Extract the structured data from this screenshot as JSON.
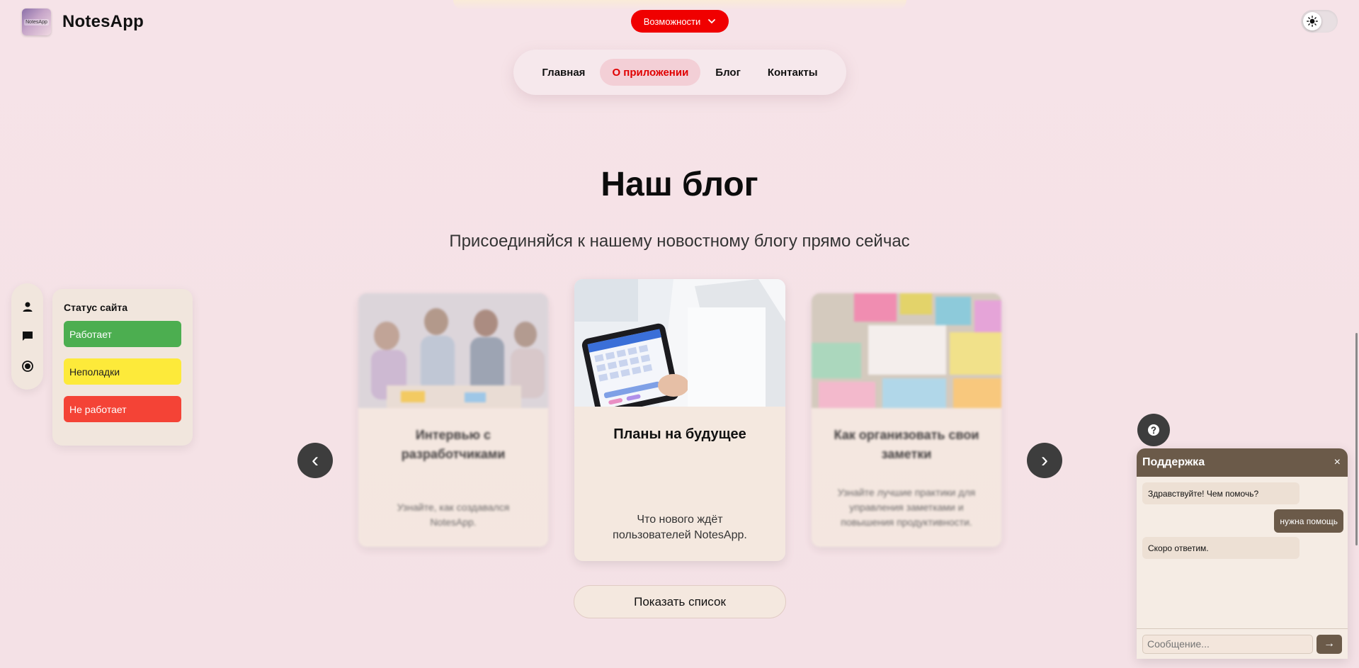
{
  "app": {
    "logo_badge": "NotesApp",
    "name": "NotesApp"
  },
  "features": {
    "label": "Возможности"
  },
  "nav": {
    "items": [
      {
        "label": "Главная",
        "active": false
      },
      {
        "label": "О приложении",
        "active": true
      },
      {
        "label": "Блог",
        "active": false
      },
      {
        "label": "Контакты",
        "active": false
      }
    ]
  },
  "blog": {
    "title": "Наш блог",
    "subtitle": "Присоединяйся к нашему новостному блогу прямо сейчас",
    "cards": [
      {
        "title": "Интервью с разработчиками",
        "desc": "Узнайте, как создавался NotesApp."
      },
      {
        "title": "Планы на будущее",
        "desc": "Что нового ждёт пользователей NotesApp."
      },
      {
        "title": "Как организовать свои заметки",
        "desc": "Узнайте лучшие практики для управления заметками и повышения продуктивности."
      }
    ],
    "prev": "‹",
    "next": "›",
    "show_list": "Показать список"
  },
  "status": {
    "title": "Статус сайта",
    "items": [
      {
        "label": "Работает",
        "color": "#4cae50"
      },
      {
        "label": "Неполадки",
        "color": "#fdea3a"
      },
      {
        "label": "Не работает",
        "color": "#f44336"
      }
    ]
  },
  "side_icons": [
    "user-icon",
    "chat-icon",
    "radio-icon"
  ],
  "chat": {
    "title": "Поддержка",
    "close": "×",
    "messages": [
      {
        "from": "bot",
        "text": "Здравствуйте! Чем помочь?"
      },
      {
        "from": "user",
        "text": "нужна помощь"
      },
      {
        "from": "bot",
        "text": "Скоро ответим."
      }
    ],
    "placeholder": "Сообщение...",
    "send": "→"
  },
  "colors": {
    "accent_red": "#f00000",
    "chat_brown": "#6b5a49",
    "dark_button": "#3d3d3d"
  }
}
